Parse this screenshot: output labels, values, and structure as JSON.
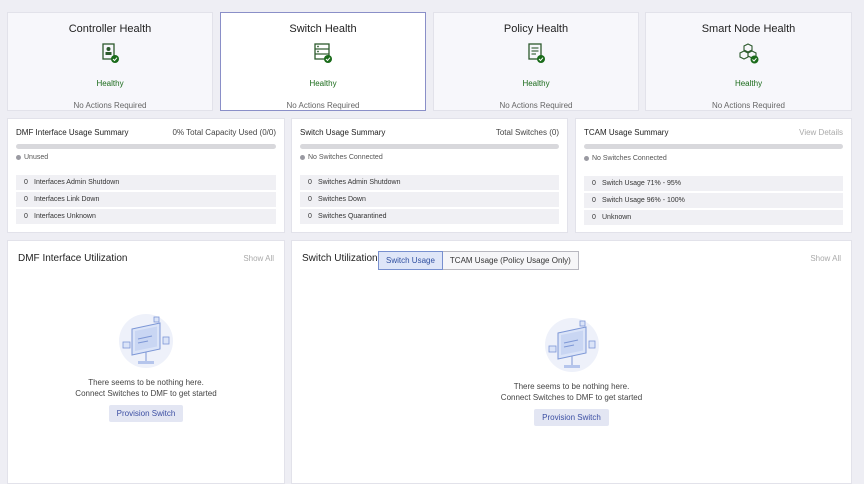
{
  "health_cards": [
    {
      "title": "Controller Health",
      "status": "Healthy",
      "actions": "No Actions Required",
      "icon": "controller-check-icon"
    },
    {
      "title": "Switch Health",
      "status": "Healthy",
      "actions": "No Actions Required",
      "icon": "switch-check-icon"
    },
    {
      "title": "Policy Health",
      "status": "Healthy",
      "actions": "No Actions Required",
      "icon": "policy-check-icon"
    },
    {
      "title": "Smart Node Health",
      "status": "Healthy",
      "actions": "No Actions Required",
      "icon": "smart-node-check-icon"
    }
  ],
  "colors": {
    "healthy": "#1a6b1a",
    "accent": "#3c4fa3",
    "selected_border": "#8a8fc8"
  },
  "dmf_interface_summary": {
    "title": "DMF Interface Usage Summary",
    "capacity": "0% Total Capacity Used (0/0)",
    "legend": "Unused",
    "rows": [
      {
        "count": "0",
        "label": "Interfaces Admin Shutdown"
      },
      {
        "count": "0",
        "label": "Interfaces Link Down"
      },
      {
        "count": "0",
        "label": "Interfaces Unknown"
      }
    ]
  },
  "switch_usage_summary": {
    "title": "Switch Usage Summary",
    "total": "Total Switches (0)",
    "legend": "No Switches Connected",
    "rows": [
      {
        "count": "0",
        "label": "Switches Admin Shutdown"
      },
      {
        "count": "0",
        "label": "Switches Down"
      },
      {
        "count": "0",
        "label": "Switches Quarantined"
      }
    ]
  },
  "tcam_usage_summary": {
    "title": "TCAM Usage Summary",
    "link": "View Details",
    "legend": "No Switches Connected",
    "rows": [
      {
        "count": "0",
        "label": "Switch Usage 71% - 95%"
      },
      {
        "count": "0",
        "label": "Switch Usage 96% - 100%"
      },
      {
        "count": "0",
        "label": "Unknown"
      }
    ]
  },
  "dmf_interface_utilization": {
    "title": "DMF Interface Utilization",
    "link": "Show All",
    "empty_line1": "There seems to be nothing here.",
    "empty_line2": "Connect Switches to DMF to get started",
    "button": "Provision Switch"
  },
  "switch_utilization": {
    "title": "Switch Utilization",
    "tabs": [
      "Switch Usage",
      "TCAM Usage (Policy Usage Only)"
    ],
    "link": "Show All",
    "empty_line1": "There seems to be nothing here.",
    "empty_line2": "Connect Switches to DMF to get started",
    "button": "Provision Switch"
  }
}
